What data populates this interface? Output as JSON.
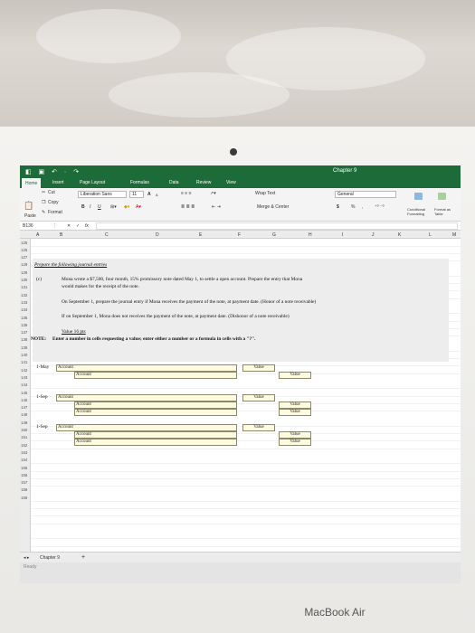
{
  "window": {
    "title": "Chapter 9"
  },
  "ribbon": {
    "tabs": [
      "Home",
      "Insert",
      "Page Layout",
      "Formulas",
      "Data",
      "Review",
      "View"
    ],
    "cut_label": "Cut",
    "copy_label": "Copy",
    "format_label": "Format",
    "paste_label": "Paste",
    "font_name": "Liberation Sans",
    "font_size": "11",
    "bold": "B",
    "italic": "I",
    "underline": "U",
    "grow_font": "A",
    "shrink_font": "A",
    "wrap_text": "Wrap Text",
    "merge_center": "Merge & Center",
    "number_format": "General",
    "currency": "$",
    "percent": "%",
    "comma": ",",
    "conditional_formatting": "Conditional Formatting",
    "format_as_table": "Format as Table"
  },
  "formula_bar": {
    "name_box": "B136",
    "fx": "fx",
    "cancel": "✕",
    "enter": "✓"
  },
  "columns": [
    "A",
    "B",
    "C",
    "D",
    "E",
    "F",
    "G",
    "H",
    "I",
    "J",
    "K",
    "L",
    "M"
  ],
  "rows": [
    "125",
    "126",
    "127",
    "128",
    "129",
    "130",
    "131",
    "132",
    "133",
    "134",
    "135",
    "136",
    "137",
    "138",
    "139",
    "140",
    "141",
    "142",
    "143",
    "144",
    "145",
    "146",
    "147",
    "148",
    "149",
    "150",
    "151",
    "152",
    "153",
    "154",
    "155",
    "156",
    "157",
    "158",
    "159"
  ],
  "sheet": {
    "heading": "Prepare the following journal entries",
    "item_label": "(c)",
    "problem_line1": "Mona wrote a $7,500, four month, 15% promissory note dated May 1, to settle a open account. Prepare the entry that Mona",
    "problem_line2": "would makes for the receipt of the note.",
    "sept_line1": "On September 1, prepare the journal entry if Mona receives the payment of the note, at payment date. (Honor of a note receivable)",
    "sept_line2": "If on September 1, Mona does not receives the payment of the note, at payment date. (Dishonor of a note receivable)",
    "value_note": "Value 16 pts",
    "note_label": "NOTE:",
    "note_text": "Enter a number in cells requesting a value; enter either a number or a formula in cells with a \"?\".",
    "entries": [
      {
        "date": "1-May",
        "debit": "Account",
        "credit": "Account",
        "value_debit": "Value",
        "value_credit": "Value"
      },
      {
        "date": "1-Sep",
        "debit": "Account",
        "credit1": "Account",
        "credit2": "Account",
        "value_debit": "Value",
        "value_credit1": "Value",
        "value_credit2": "Value"
      },
      {
        "date": "1-Sep",
        "debit": "Account",
        "credit1": "Account",
        "credit2": "Account",
        "value_debit": "Value",
        "value_credit1": "Value",
        "value_credit2": "Value"
      }
    ]
  },
  "sheet_tabs": {
    "active": "Chapter 9",
    "add": "+"
  },
  "status": {
    "text": "Ready"
  },
  "device": {
    "brand": "MacBook Air"
  }
}
